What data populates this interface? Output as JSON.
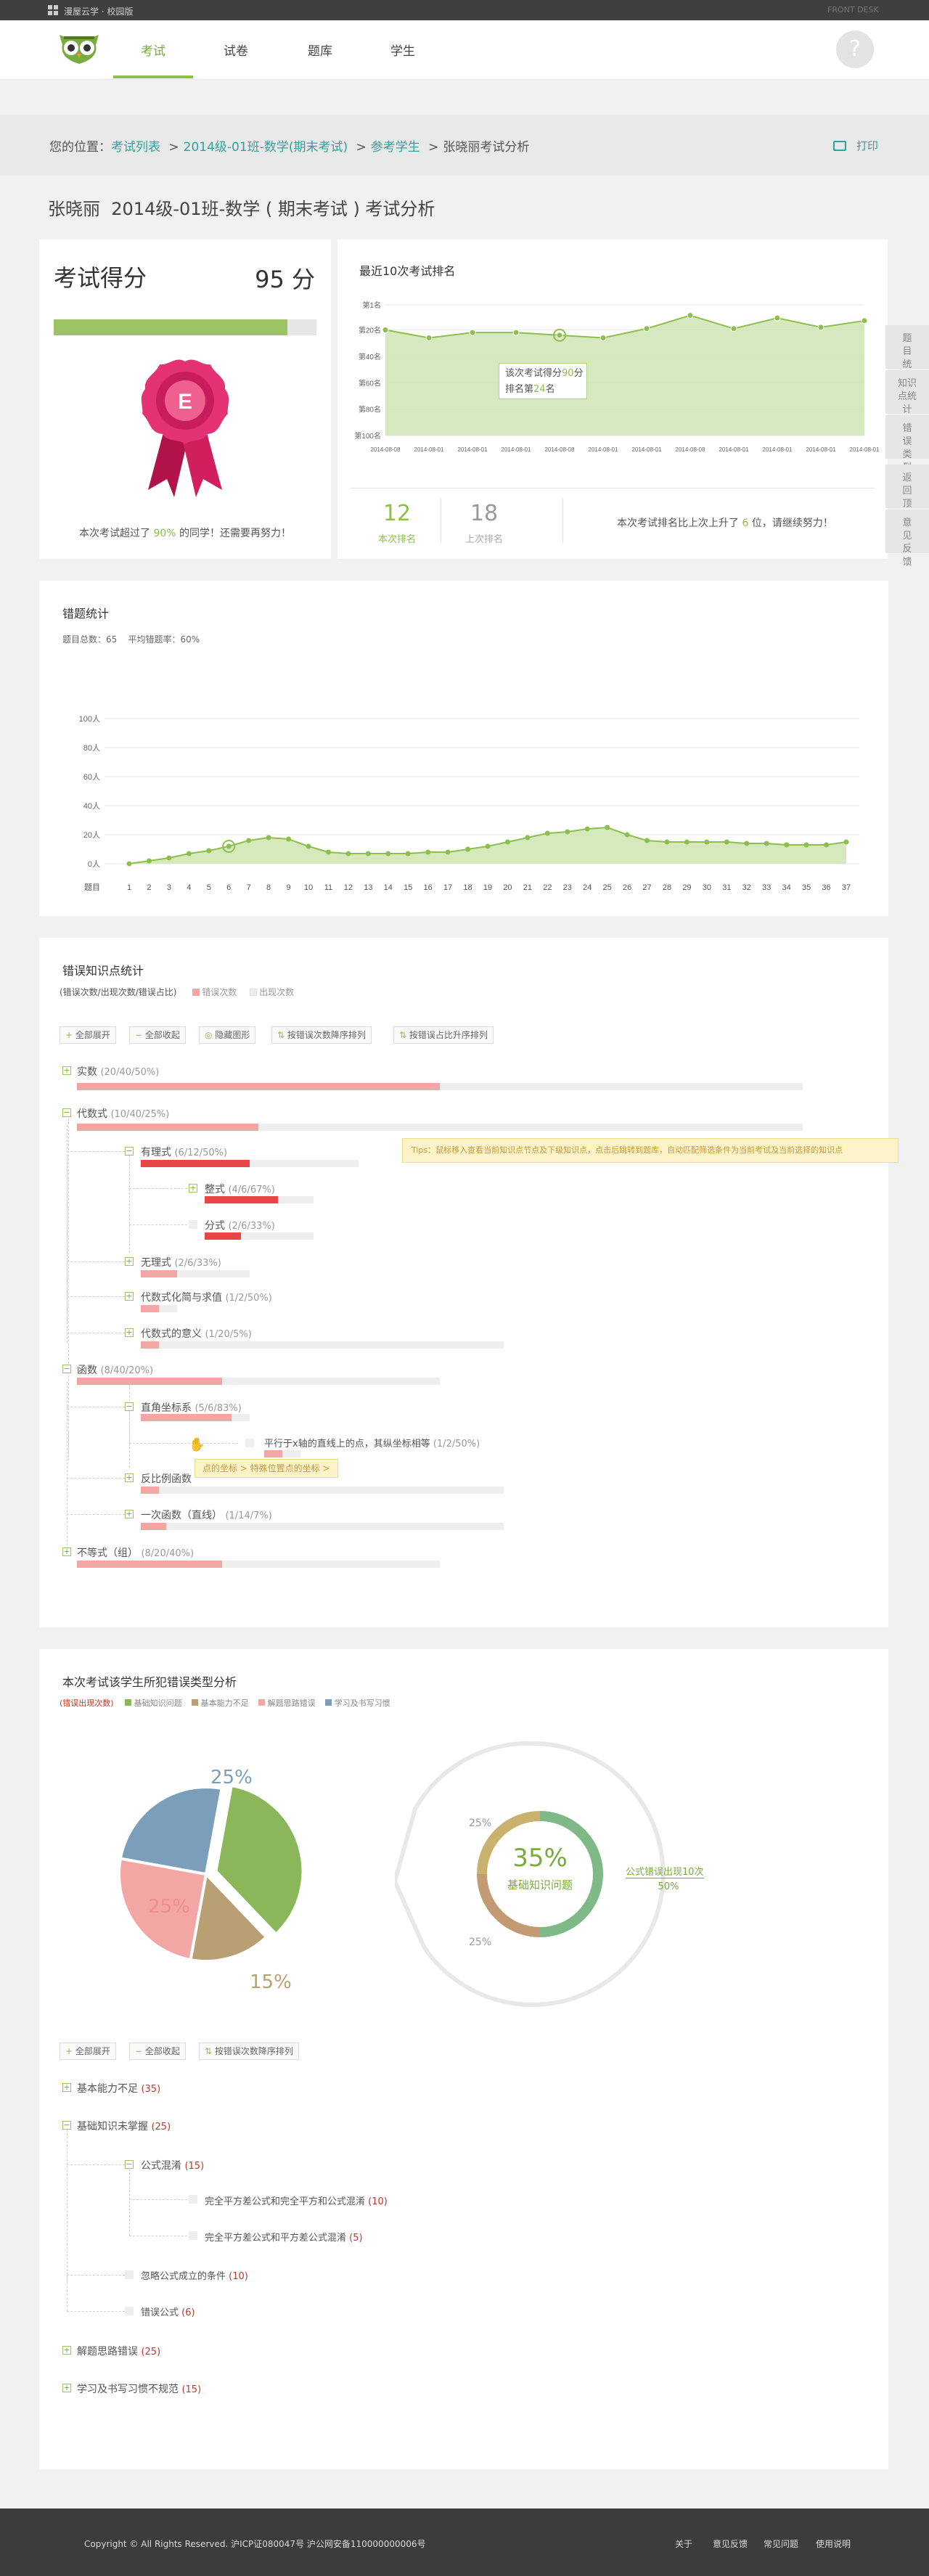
{
  "topbar": {
    "brand": "漫屋云学 · 校园版",
    "login": "FRONT DESK"
  },
  "nav": [
    {
      "label": "考试",
      "active": true
    },
    {
      "label": "试卷"
    },
    {
      "label": "题库"
    },
    {
      "label": "学生"
    }
  ],
  "crumb": {
    "prefix": "您的位置：",
    "items": [
      "考试列表",
      "2014级-01班-数学(期末考试)",
      "参考学生"
    ],
    "sep": ">",
    "current": "张晓丽考试分析",
    "print": "打印"
  },
  "page_title": "张晓丽  2014级-01班-数学 ( 期末考试 ) 考试分析",
  "score": {
    "label": "考试得分",
    "value": "95 分",
    "progress": 0.89,
    "beat_pre": "本次考试超过了",
    "beat_pct": "90%",
    "beat_post": "的同学！还需要再努力！",
    "badge_letter": "E"
  },
  "rank": {
    "title": "最近10次考试排名",
    "y_ticks": [
      "第1名",
      "第20名",
      "第40名",
      "第60名",
      "第80名",
      "第100名"
    ],
    "tip_l1_pre": "该次考试得分",
    "tip_l1_val": "90",
    "tip_l1_post": "分",
    "tip_l2_pre": "排名第",
    "tip_l2_val": "24",
    "tip_l2_post": "名",
    "now_val": "12",
    "now_label": "本次排名",
    "prev_val": "18",
    "prev_label": "上次排名",
    "msg_pre": "本次考试排名比上次上升了",
    "msg_val": "6",
    "msg_post": "位，请继续努力！"
  },
  "side_tabs": [
    "题目统计",
    "知识点统计",
    "错误类型",
    "返回顶部",
    "意见反馈"
  ],
  "errstat": {
    "title": "错题统计",
    "summary": "题目总数：65    平均错题率：60%",
    "y_ticks": [
      "100人",
      "80人",
      "60人",
      "40人",
      "20人",
      "0人"
    ],
    "x_label": "题目"
  },
  "kp": {
    "title": "错误知识点统计",
    "sub": "(错误次数/出现次数/错误占比)",
    "leg1": "错误次数",
    "leg2": "出现次数",
    "buttons": [
      "全部展开",
      "全部收起",
      "隐藏图形",
      "按错误次数降序排列",
      "按错误占比升序排列"
    ],
    "tip": "Tips：鼠标移入查看当前知识点节点及下级知识点，点击后跳转到题库，自动匹配筛选条件为当前考试及当前选择的知识点",
    "hover_tip": "点的坐标 > 特殊位置点的坐标 >",
    "nodes": [
      {
        "label": "实数",
        "cnt": "(20/40/50%)"
      },
      {
        "label": "代数式",
        "cnt": "(10/40/25%)"
      },
      {
        "label": "有理式",
        "cnt": "(6/12/50%)"
      },
      {
        "label": "整式",
        "cnt": "(4/6/67%)"
      },
      {
        "label": "分式",
        "cnt": "(2/6/33%)"
      },
      {
        "label": "无理式",
        "cnt": "(2/6/33%)"
      },
      {
        "label": "代数式化简与求值",
        "cnt": "(1/2/50%)"
      },
      {
        "label": "代数式的意义",
        "cnt": "(1/20/5%)"
      },
      {
        "label": "函数",
        "cnt": "(8/40/20%)"
      },
      {
        "label": "直角坐标系",
        "cnt": "(5/6/83%)"
      },
      {
        "label": "平行于x轴的直线上的点，其纵坐标相等",
        "cnt": "(1/2/50%)"
      },
      {
        "label": "反比例函数",
        "cnt": ""
      },
      {
        "label": "一次函数（直线）",
        "cnt": "(1/14/7%)"
      },
      {
        "label": "不等式（组）",
        "cnt": "(8/20/40%)"
      }
    ]
  },
  "et": {
    "title": "本次考试该学生所犯错误类型分析",
    "sub": "(错误出现次数)",
    "legend": [
      "基础知识问题",
      "基本能力不足",
      "解题思路错误",
      "学习及书写习惯"
    ],
    "pie_labels": [
      "25%",
      "25%",
      "15%"
    ],
    "donut_center": "35%",
    "donut_label": "基础知识问题",
    "donut_l1": "25%",
    "donut_l2": "25%",
    "donut_side": "公式错误出现10次",
    "donut_side_pct": "50%",
    "buttons": [
      "全部展开",
      "全部收起",
      "按错误次数降序排列"
    ],
    "tree": [
      {
        "label": "基本能力不足",
        "cnt": "(35)"
      },
      {
        "label": "基础知识未掌握",
        "cnt": "(25)"
      },
      {
        "label": "公式混淆",
        "cnt": "(15)"
      },
      {
        "label": "完全平方差公式和完全平方和公式混淆",
        "cnt": "(10)"
      },
      {
        "label": "完全平方差公式和平方差公式混淆",
        "cnt": "(5)"
      },
      {
        "label": "忽略公式成立的条件",
        "cnt": "(10)"
      },
      {
        "label": "错误公式",
        "cnt": "(6)"
      },
      {
        "label": "解题思路错误",
        "cnt": "(25)"
      },
      {
        "label": "学习及书写习惯不规范",
        "cnt": "(15)"
      }
    ]
  },
  "footer": {
    "copy": "Copyright © All Rights Reserved. 沪ICP证080047号 沪公网安备110000000006号",
    "links": [
      "关于",
      "意见反馈",
      "常见问题",
      "使用说明"
    ]
  },
  "chart_data": [
    {
      "type": "area",
      "title": "最近10次考试排名",
      "x": [
        "2014-08-08",
        "2014-08-01",
        "2014-08-01",
        "2014-08-01",
        "2014-08-08",
        "2014-08-01",
        "2014-08-01",
        "2014-08-08",
        "2014-08-01",
        "2014-08-01",
        "2014-08-01",
        "2014-08-01"
      ],
      "values": [
        20,
        26,
        22,
        22,
        24,
        26,
        19,
        9,
        19,
        11,
        18,
        13
      ],
      "ylim": [
        1,
        100
      ],
      "reversed": true
    },
    {
      "type": "area",
      "title": "错题统计",
      "xlabel": "题目",
      "ylabel": "",
      "x": [
        1,
        2,
        3,
        4,
        5,
        6,
        7,
        8,
        9,
        10,
        11,
        12,
        13,
        14,
        15,
        16,
        17,
        18,
        19,
        20,
        21,
        22,
        23,
        24,
        25,
        26,
        27,
        28,
        29,
        30,
        31,
        32,
        33,
        34,
        35,
        36,
        37
      ],
      "values": [
        0,
        2,
        4,
        7,
        9,
        12,
        16,
        18,
        17,
        12,
        8,
        7,
        7,
        7,
        7,
        8,
        8,
        10,
        12,
        15,
        18,
        21,
        22,
        24,
        25,
        20,
        16,
        15,
        15,
        15,
        15,
        14,
        14,
        13,
        13,
        13,
        15
      ],
      "ylim": [
        0,
        100
      ]
    },
    {
      "type": "pie",
      "categories": [
        "基础知识问题",
        "基本能力不足",
        "解题思路错误",
        "学习及书写习惯"
      ],
      "values": [
        35,
        15,
        25,
        25
      ],
      "colors": [
        "#8cb65a",
        "#b8a074",
        "#f3a7a4",
        "#7b9fba"
      ]
    }
  ]
}
